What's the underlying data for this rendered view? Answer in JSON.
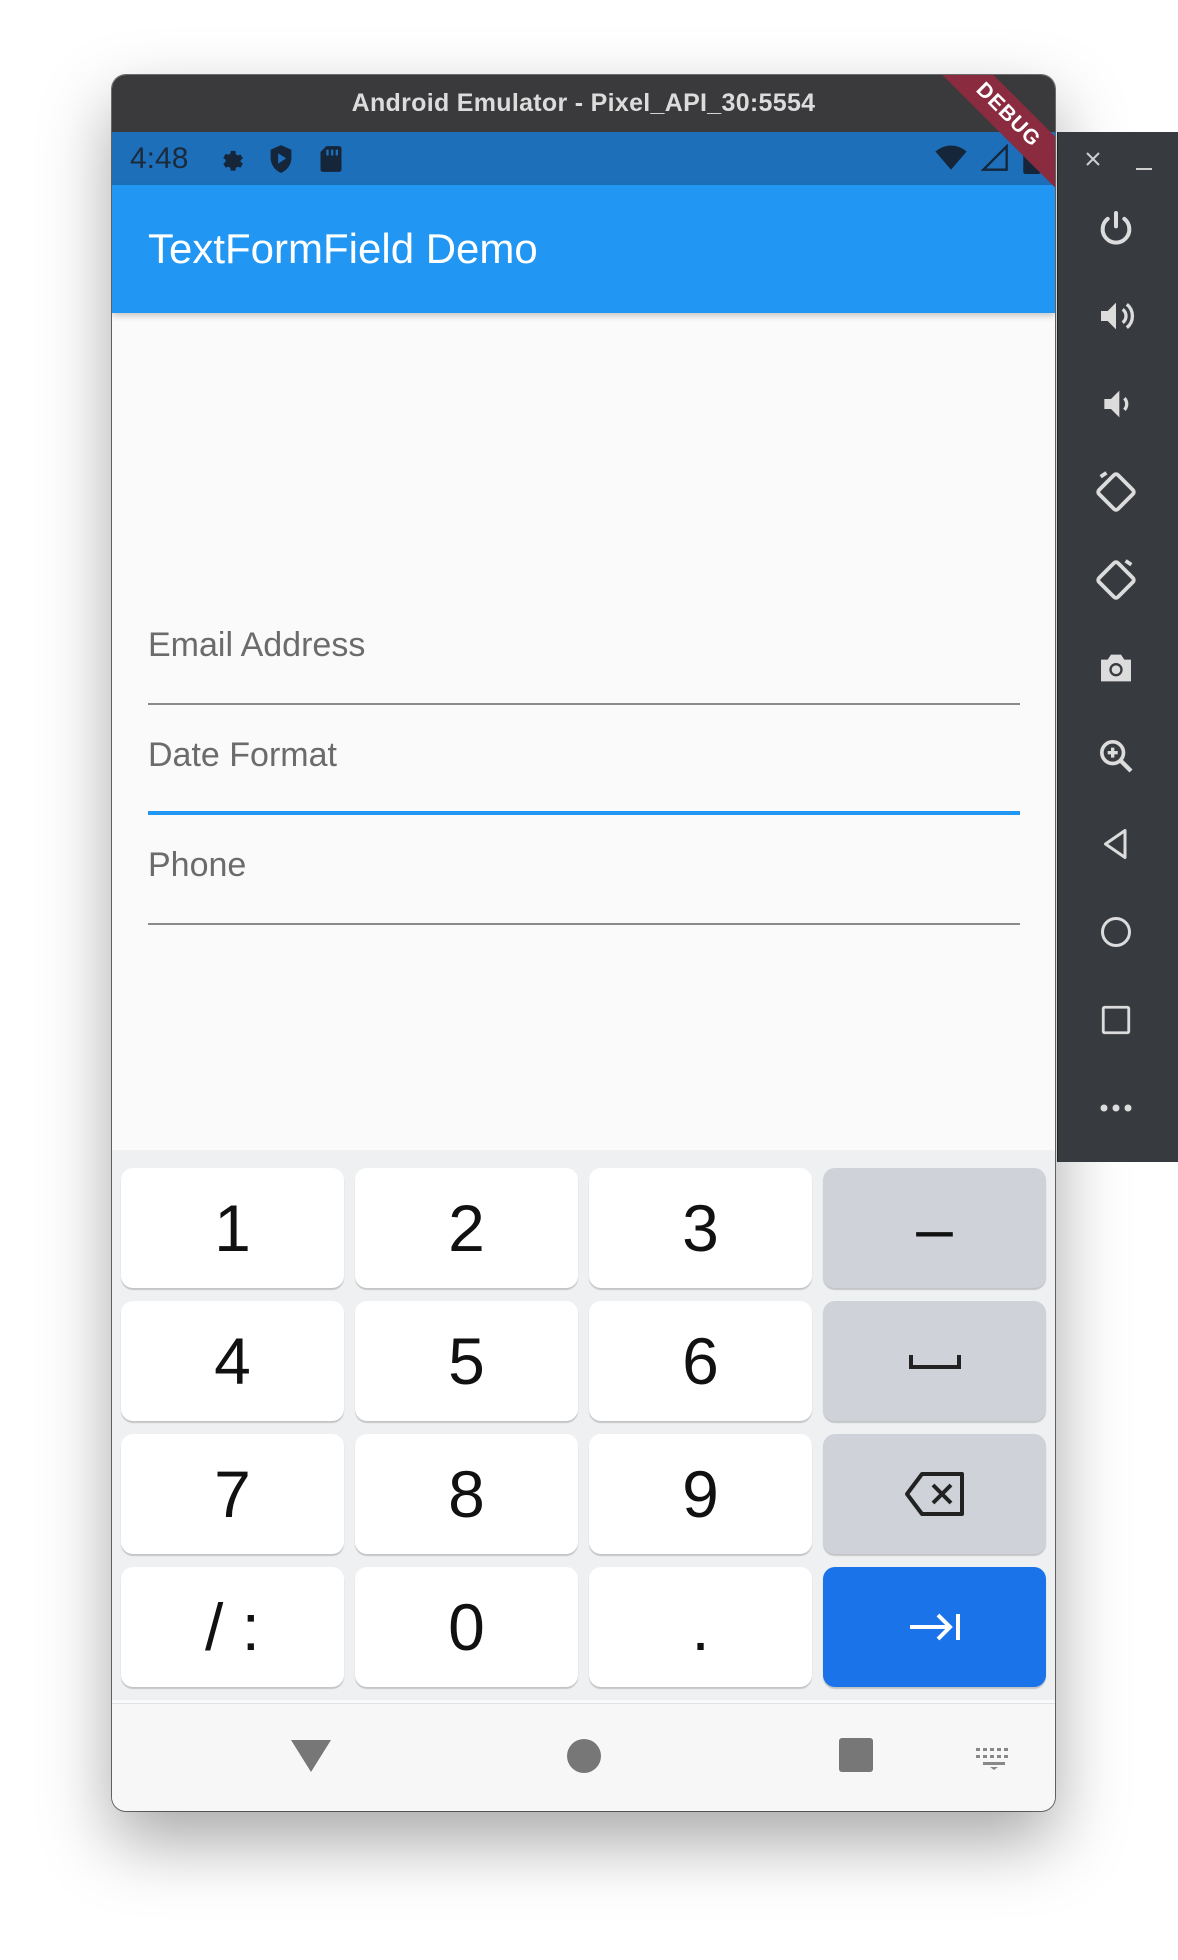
{
  "window": {
    "title": "Android Emulator - Pixel_API_30:5554"
  },
  "status_bar": {
    "time": "4:48"
  },
  "app_bar": {
    "title": "TextFormField Demo",
    "debug_banner": "DEBUG"
  },
  "form": {
    "fields": [
      {
        "label": "Email Address",
        "focused": false
      },
      {
        "label": "Date Format",
        "focused": true
      },
      {
        "label": "Phone",
        "focused": false
      }
    ]
  },
  "keyboard": {
    "rows": [
      [
        "1",
        "2",
        "3",
        "–"
      ],
      [
        "4",
        "5",
        "6",
        "space"
      ],
      [
        "7",
        "8",
        "9",
        "backspace"
      ],
      [
        "/ :",
        "0",
        ".",
        "next"
      ]
    ],
    "action_color": "#1a73e8"
  },
  "emulator_panel": {
    "buttons": [
      "power",
      "volume-up",
      "volume-down",
      "rotate-left",
      "rotate-right",
      "camera",
      "zoom",
      "back",
      "home",
      "overview",
      "more"
    ]
  },
  "colors": {
    "app_bar": "#2196f3",
    "status_bar": "#1d6fba",
    "focus_underline": "#2196f3"
  }
}
